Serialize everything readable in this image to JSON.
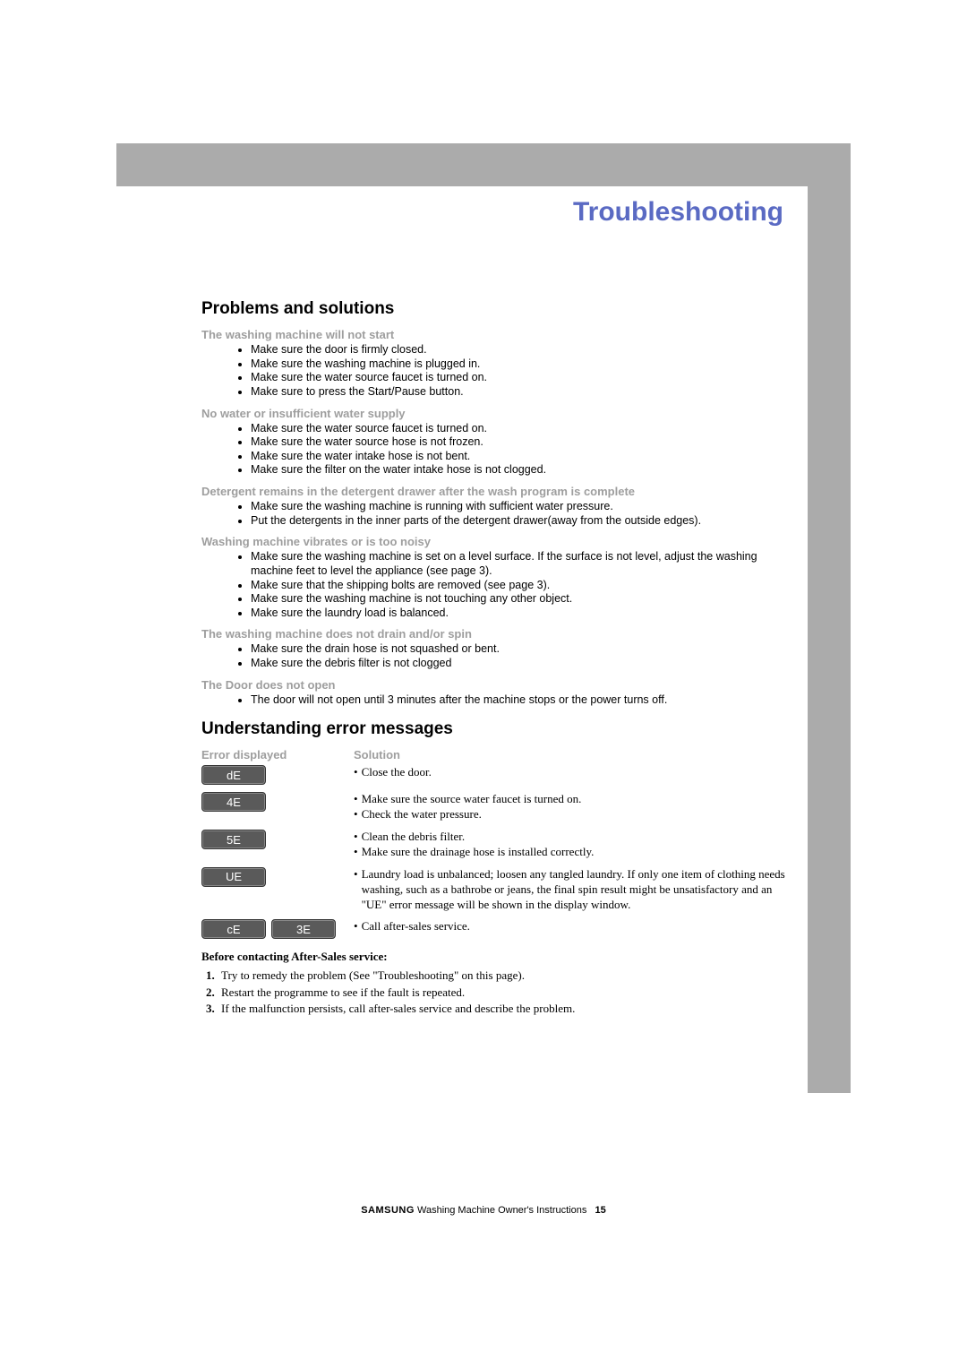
{
  "title": "Troubleshooting",
  "section1": {
    "heading": "Problems and solutions",
    "problems": [
      {
        "title": "The washing machine will not start",
        "items": [
          "Make sure the door is firmly closed.",
          "Make sure the washing machine is plugged in.",
          "Make sure the water source faucet is turned on.",
          "Make sure to press the Start/Pause button."
        ]
      },
      {
        "title": "No water or insufficient water supply",
        "items": [
          "Make sure the water source faucet is turned on.",
          "Make sure the water source hose is not frozen.",
          "Make sure the water intake hose is not bent.",
          "Make sure the filter on the water intake hose is not clogged."
        ]
      },
      {
        "title": "Detergent remains in the detergent drawer after the wash program is complete",
        "items": [
          "Make sure the washing machine is running with sufficient water pressure.",
          "Put the detergents in the inner parts of the detergent drawer(away from the outside edges)."
        ]
      },
      {
        "title": "Washing machine vibrates or is too noisy",
        "items": [
          "Make sure the washing machine is set on a level surface.  If the surface is not level, adjust the washing machine feet to level the appliance (see page 3).",
          "Make sure that the shipping bolts are removed (see page 3).",
          "Make sure the washing machine is not touching any other object.",
          "Make sure the laundry load is balanced."
        ]
      },
      {
        "title": "The washing machine does not drain and/or spin",
        "items": [
          "Make sure the drain hose is not squashed or bent.",
          "Make sure the debris filter is not clogged"
        ]
      },
      {
        "title": "The Door does not open",
        "items": [
          "The door will not open until 3 minutes after the machine stops or the power turns off."
        ]
      }
    ]
  },
  "section2": {
    "heading": "Understanding error messages",
    "col1": "Error displayed",
    "col2": "Solution",
    "errors": [
      {
        "codes": [
          "dE"
        ],
        "solutions": [
          "Close the door."
        ]
      },
      {
        "codes": [
          "4E"
        ],
        "solutions": [
          "Make sure the source water faucet is turned on.",
          "Check the water pressure."
        ]
      },
      {
        "codes": [
          "5E"
        ],
        "solutions": [
          "Clean the debris filter.",
          "Make sure the drainage hose is installed correctly."
        ]
      },
      {
        "codes": [
          "UE"
        ],
        "solutions": [
          "Laundry load is unbalanced; loosen any tangled laundry. If only one item of clothing needs washing, such as a bathrobe or jeans, the final spin result might be unsatisfactory and an \"UE\" error message will be shown in the display window."
        ]
      },
      {
        "codes": [
          "cE",
          "3E"
        ],
        "solutions": [
          "Call after-sales service."
        ]
      }
    ],
    "before": {
      "heading": "Before contacting After-Sales service:",
      "items": [
        "Try to remedy the problem (See \"Troubleshooting\" on this page).",
        "Restart the programme to see if the fault is repeated.",
        "If the malfunction persists, call after-sales service and describe the problem."
      ]
    }
  },
  "footer": {
    "brand": "SAMSUNG",
    "text": "Washing Machine Owner's Instructions",
    "page": "15"
  }
}
